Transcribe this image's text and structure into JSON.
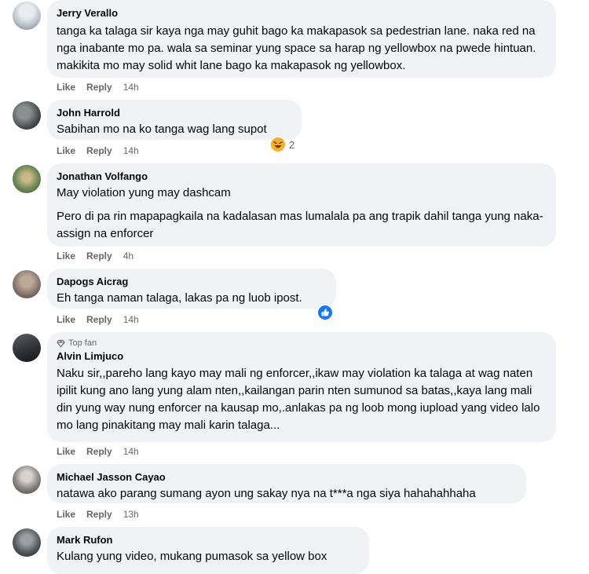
{
  "comments": [
    {
      "name": "Jerry Verallo",
      "text": "tanga ka talaga sir kaya nga may guhit bago ka makapasok sa pedestrian lane. naka red na nga inabante mo pa. wala sa seminar yung space sa harap ng yellowbox na pwede hintuan. makikita mo may solid whit lane bago ka makapasok ng yellowbox.",
      "like": "Like",
      "reply": "Reply",
      "time": "14h"
    },
    {
      "name": "John Harrold",
      "text": "Sabihan mo na ko tanga wag lang supot",
      "like": "Like",
      "reply": "Reply",
      "time": "14h",
      "reaction": {
        "icon": "haha-icon",
        "count": "2"
      }
    },
    {
      "name": "Jonathan Volfango",
      "text1": "May violation yung may dashcam",
      "text2": "Pero di pa rin mapapagkaila na kadalasan mas lumalala pa ang trapik dahil tanga yung naka-assign na enforcer",
      "like": "Like",
      "reply": "Reply",
      "time": "4h"
    },
    {
      "name": "Dapogs Aicrag",
      "text": "Eh tanga naman talaga, lakas pa ng luob ipost.",
      "like": "Like",
      "reply": "Reply",
      "time": "14h",
      "reaction": {
        "icon": "like-icon",
        "count": ""
      }
    },
    {
      "badge": "Top fan",
      "name": "Alvin Limjuco",
      "text": "Naku sir,,pareho lang kayo may mali ng enforcer,,ikaw may violation ka talaga at wag naten ipilit kung ano lang yung alam nten,,kailangan parin nten sumunod sa batas,,kaya lang mali din yung way nung enforcer na kausap mo,.anlakas pa ng loob mong iupload yang video lalo mo lang pinakitang may mali karin talaga...",
      "like": "Like",
      "reply": "Reply",
      "time": "14h"
    },
    {
      "name": "Michael Jasson Cayao",
      "text": "natawa ako parang sumang ayon ung sakay nya na t***a nga siya hahahahhaha",
      "like": "Like",
      "reply": "Reply",
      "time": "13h"
    },
    {
      "name": "Mark Rufon",
      "text": "Kulang yung video, mukang pumasok sa yellow box"
    }
  ],
  "colors": {
    "bubble": "#f0f2f5",
    "meta": "#65676b",
    "like_blue": "#1877f2",
    "haha_yellow": "#f7b125"
  }
}
